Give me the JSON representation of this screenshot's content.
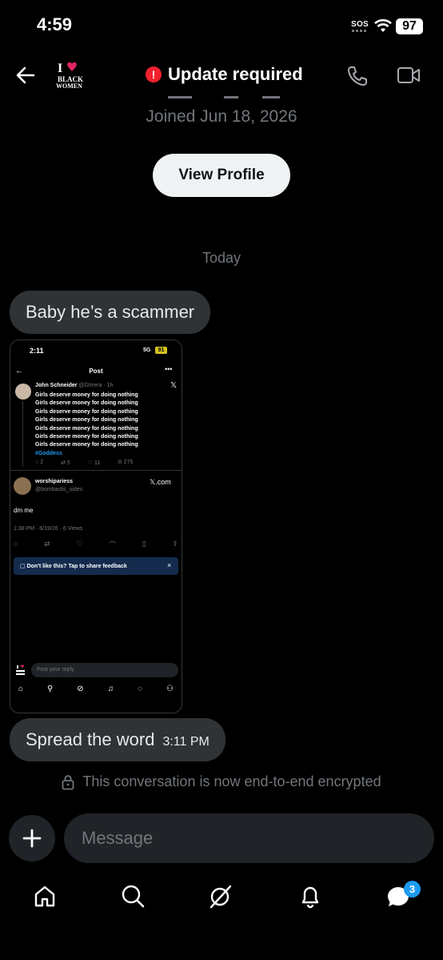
{
  "status_bar": {
    "time": "4:59",
    "sos": "SOS",
    "battery": "97"
  },
  "header": {
    "title": "Update required",
    "joined": "Joined Jun 18, 2026",
    "view_profile": "View Profile",
    "logo_text": [
      "I",
      "BLACK",
      "WOMEN"
    ]
  },
  "conversation": {
    "day_label": "Today",
    "messages": [
      {
        "text": "Baby he’s a scammer"
      },
      {
        "text": "Spread the word",
        "time": "3:11 PM"
      }
    ],
    "encryption_notice": "This conversation is now end-to-end encrypted"
  },
  "embedded_screenshot": {
    "time": "2:11",
    "network": "5G",
    "battery": "91",
    "title": "Post",
    "author": "John Schneider",
    "handle": "@DIrrera · 1h",
    "lines": [
      "Girls deserve money for doing nothing",
      "Girls deserve money for doing nothing",
      "Girls deserve money for doing nothing",
      "Girls deserve money for doing nothing",
      "Girls deserve money for doing nothing",
      "Girls deserve money for doing nothing",
      "Girls deserve money for doing nothing"
    ],
    "hashtag": "#Goddess",
    "stats": {
      "replies": "2",
      "reposts": "5",
      "likes": "11",
      "views": "275"
    },
    "reply_name": "worshipariess",
    "reply_handle": "@bombastic_sides",
    "reply_brand": "𝕏.com",
    "reply_text": "dm me",
    "reply_meta": "1:38 PM · 6/19/26 · 6 Views",
    "feedback": "Don't like this? Tap to share feedback",
    "reply_placeholder": "Post your reply"
  },
  "composer": {
    "placeholder": "Message"
  },
  "bottom_nav": {
    "messages_badge": "3"
  },
  "colors": {
    "accent": "#1d9bf0",
    "alert": "#f4212e",
    "bubble": "#2f3336",
    "muted": "#71767b"
  }
}
